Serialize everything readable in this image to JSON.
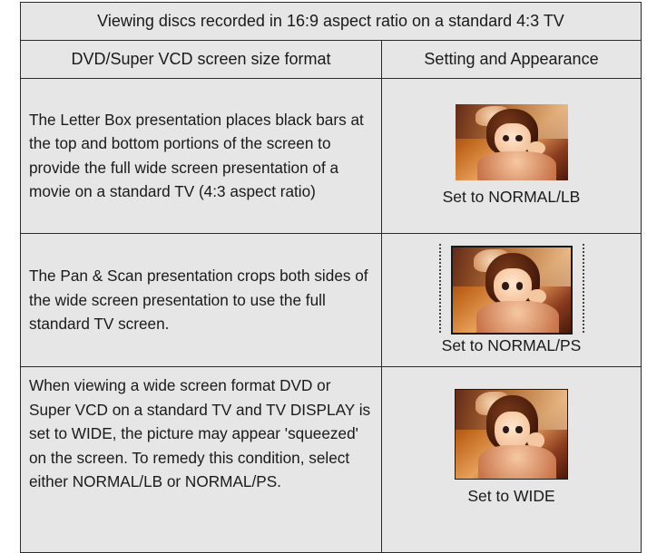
{
  "table": {
    "title": "Viewing discs recorded in 16:9 aspect ratio on a standard 4:3 TV",
    "headers": {
      "format": "DVD/Super VCD screen size format",
      "setting": "Setting and Appearance"
    },
    "rows": [
      {
        "description": "The Letter Box presentation places black bars at the top and bottom portions of the screen to provide the full wide screen presentation of a movie on a standard TV (4:3 aspect ratio)",
        "setting": "Set to NORMAL/LB"
      },
      {
        "description": "The Pan & Scan presentation crops both sides of the wide screen presentation to use the full standard TV screen.",
        "setting": "Set to NORMAL/PS"
      },
      {
        "description": "When viewing a wide screen format DVD or Super VCD on a standard TV and TV DISPLAY is set to WIDE, the picture may appear 'squeezed' on the screen. To remedy this condition, select either NORMAL/LB or NORMAL/PS.",
        "setting": "Set to WIDE"
      }
    ]
  }
}
